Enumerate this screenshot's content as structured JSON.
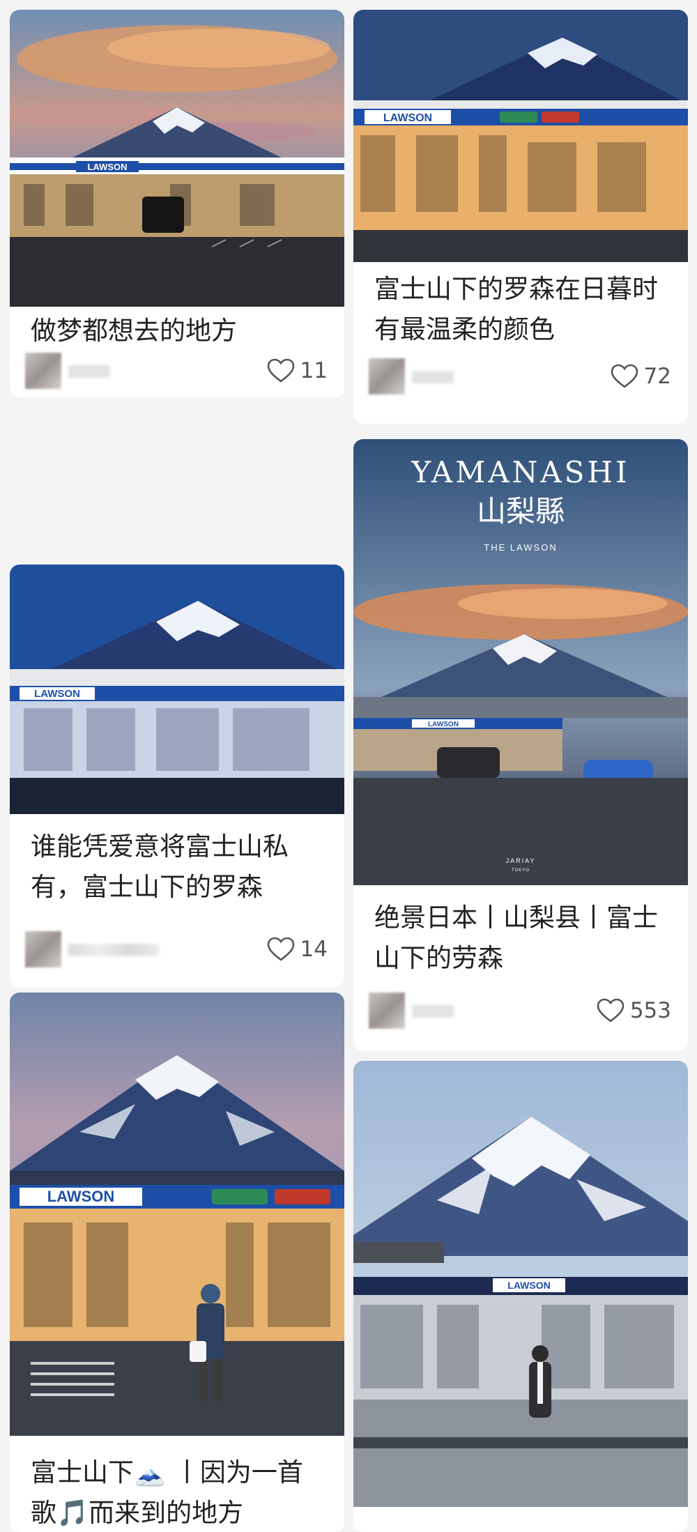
{
  "feed": {
    "cards": [
      {
        "title": "做梦都想去的地方",
        "likes": "11",
        "photo_icon": "fuji-lawson-dusk-photo"
      },
      {
        "title": "富士山下的罗森在日暮时有最温柔的颜色",
        "likes": "72",
        "photo_icon": "fuji-lawson-evening-photo"
      },
      {
        "title": "谁能凭爱意将富士山私有，富士山下的罗森",
        "likes": "14",
        "photo_icon": "fuji-lawson-blue-hour-photo"
      },
      {
        "title": "绝景日本丨山梨县丨富士山下的劳森",
        "likes": "553",
        "photo_icon": "yamanashi-poster-photo",
        "poster": {
          "heading": "YAMANASHI",
          "kanji": "山梨縣",
          "sub": "THE LAWSON",
          "credit": "JARIAY",
          "credit_sub": "TOKYO"
        }
      },
      {
        "title": "富士山下🗻 丨因为一首歌🎵而来到的地方",
        "likes": "",
        "photo_icon": "fuji-lawson-woman-photo"
      },
      {
        "title": "",
        "likes": "",
        "photo_icon": "fuji-lawson-daytime-photo"
      }
    ],
    "store_signs": [
      "LAWSON",
      "LAWSON",
      "LAWSON",
      "LAWSON",
      "LAWSON",
      "LAWSON"
    ],
    "colors": {
      "lawson_blue": "#1e4fa8",
      "title_text": "#222222",
      "like_text": "#555555"
    }
  }
}
